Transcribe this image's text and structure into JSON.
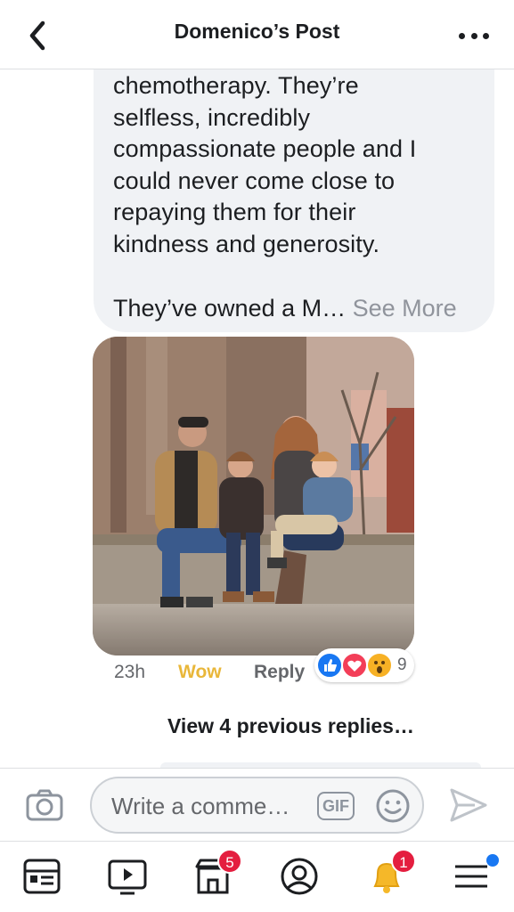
{
  "header": {
    "title": "Domenico’s Post",
    "back_icon": "chevron-left-icon",
    "more_icon": "more-horizontal-icon"
  },
  "comment": {
    "lines": [
      "chemotherapy.  They’re",
      "selfless, incredibly",
      "compassionate people and I",
      "could never come close to",
      "repaying them for their",
      "kindness and generosity."
    ],
    "truncated_line": "They’ve owned a M… ",
    "see_more": "See More",
    "time": "23h",
    "own_reaction": "Wow",
    "reply": "Reply",
    "reactions": {
      "types": [
        "like",
        "love",
        "wow"
      ],
      "count": "9"
    }
  },
  "thread": {
    "view_previous": "View 4 previous replies…"
  },
  "composer": {
    "placeholder": "Write a comme…",
    "gif_label": "GIF",
    "camera_icon": "camera-icon",
    "emoji_icon": "emoji-icon",
    "send_icon": "send-icon"
  },
  "tabbar": {
    "items": [
      {
        "name": "news-feed",
        "icon": "news-feed-icon"
      },
      {
        "name": "watch",
        "icon": "video-icon"
      },
      {
        "name": "marketplace",
        "icon": "marketplace-icon",
        "badge": "5"
      },
      {
        "name": "profile",
        "icon": "profile-icon"
      },
      {
        "name": "notifications",
        "icon": "bell-icon",
        "badge": "1"
      },
      {
        "name": "menu",
        "icon": "menu-icon",
        "dot": true
      }
    ]
  },
  "colors": {
    "wow": "#e9b73a",
    "badge": "#e41e3f",
    "bubble": "#f0f2f5",
    "accent": "#1877f2"
  }
}
